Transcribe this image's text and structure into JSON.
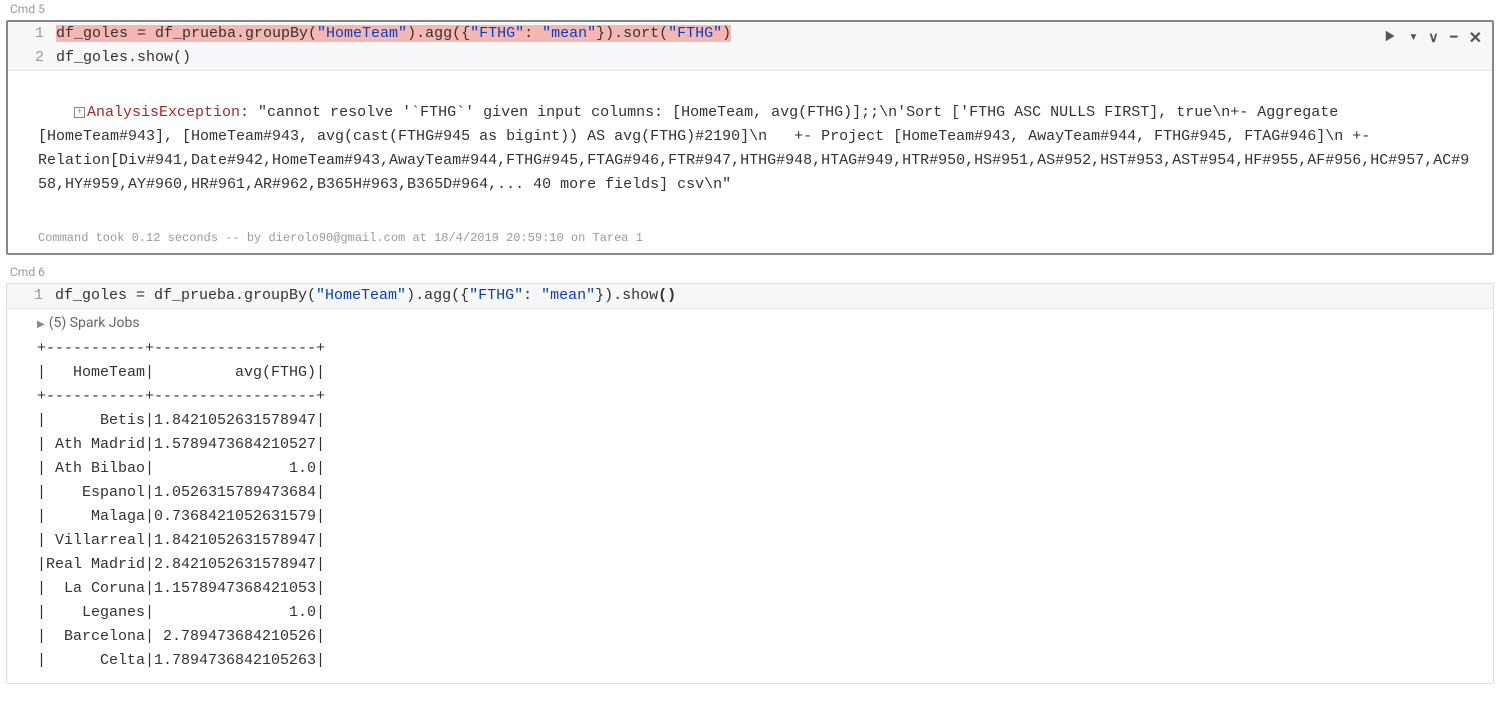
{
  "cells": [
    {
      "label": "Cmd 5",
      "lines": [
        {
          "num": "1",
          "tokens": [
            {
              "t": "df_goles = df_prueba.groupBy(",
              "cls": "tk-fn",
              "hl": true
            },
            {
              "t": "\"HomeTeam\"",
              "cls": "tk-str",
              "hl": true
            },
            {
              "t": ").agg({",
              "cls": "tk-fn",
              "hl": true
            },
            {
              "t": "\"FTHG\"",
              "cls": "tk-str",
              "hl": true
            },
            {
              "t": ": ",
              "cls": "tk-fn",
              "hl": true
            },
            {
              "t": "\"mean\"",
              "cls": "tk-str",
              "hl": true
            },
            {
              "t": "}).sort(",
              "cls": "tk-fn",
              "hl": true
            },
            {
              "t": "\"FTHG\"",
              "cls": "tk-str",
              "hl": true
            },
            {
              "t": ")",
              "cls": "tk-fn",
              "hl": true
            }
          ]
        },
        {
          "num": "2",
          "tokens": [
            {
              "t": "df_goles.show()",
              "cls": "tk-fn"
            }
          ]
        }
      ],
      "error_label": "AnalysisException",
      "error_body": ": \"cannot resolve '`FTHG`' given input columns: [HomeTeam, avg(FTHG)];;\\n'Sort ['FTHG ASC NULLS FIRST], true\\n+- Aggregate [HomeTeam#943], [HomeTeam#943, avg(cast(FTHG#945 as bigint)) AS avg(FTHG)#2190]\\n   +- Project [HomeTeam#943, AwayTeam#944, FTHG#945, FTAG#946]\\n +- Relation[Div#941,Date#942,HomeTeam#943,AwayTeam#944,FTHG#945,FTAG#946,FTR#947,HTHG#948,HTAG#949,HTR#950,HS#951,AS#952,HST#953,AST#954,HF#955,AF#956,HC#957,AC#958,HY#959,AY#960,HR#961,AR#962,B365H#963,B365D#964,... 40 more fields] csv\\n\"",
      "meta": "Command took 0.12 seconds -- by dierolo90@gmail.com at 18/4/2019 20:59:10 on Tarea 1"
    },
    {
      "label": "Cmd 6",
      "lines": [
        {
          "num": "1",
          "tokens": [
            {
              "t": "df_goles = df_prueba.groupBy(",
              "cls": "tk-fn"
            },
            {
              "t": "\"HomeTeam\"",
              "cls": "tk-str"
            },
            {
              "t": ").agg({",
              "cls": "tk-fn"
            },
            {
              "t": "\"FTHG\"",
              "cls": "tk-str"
            },
            {
              "t": ": ",
              "cls": "tk-fn"
            },
            {
              "t": "\"mean\"",
              "cls": "tk-str"
            },
            {
              "t": "}).show",
              "cls": "tk-fn"
            },
            {
              "t": "()",
              "cls": "tk-fn",
              "bold": true
            }
          ]
        }
      ],
      "jobs_label": "(5) Spark Jobs",
      "table_output": "+-----------+------------------+\n|   HomeTeam|         avg(FTHG)|\n+-----------+------------------+\n|      Betis|1.8421052631578947|\n| Ath Madrid|1.5789473684210527|\n| Ath Bilbao|               1.0|\n|    Espanol|1.0526315789473684|\n|     Malaga|0.7368421052631579|\n| Villarreal|1.8421052631578947|\n|Real Madrid|2.8421052631578947|\n|  La Coruna|1.1578947368421053|\n|    Leganes|               1.0|\n|  Barcelona| 2.789473684210526|\n|      Celta|1.7894736842105263|"
    }
  ],
  "toolbar_icons": {
    "run": "run-icon",
    "down": "chevron-down-icon",
    "minimize": "minimize-icon",
    "close": "close-icon"
  }
}
